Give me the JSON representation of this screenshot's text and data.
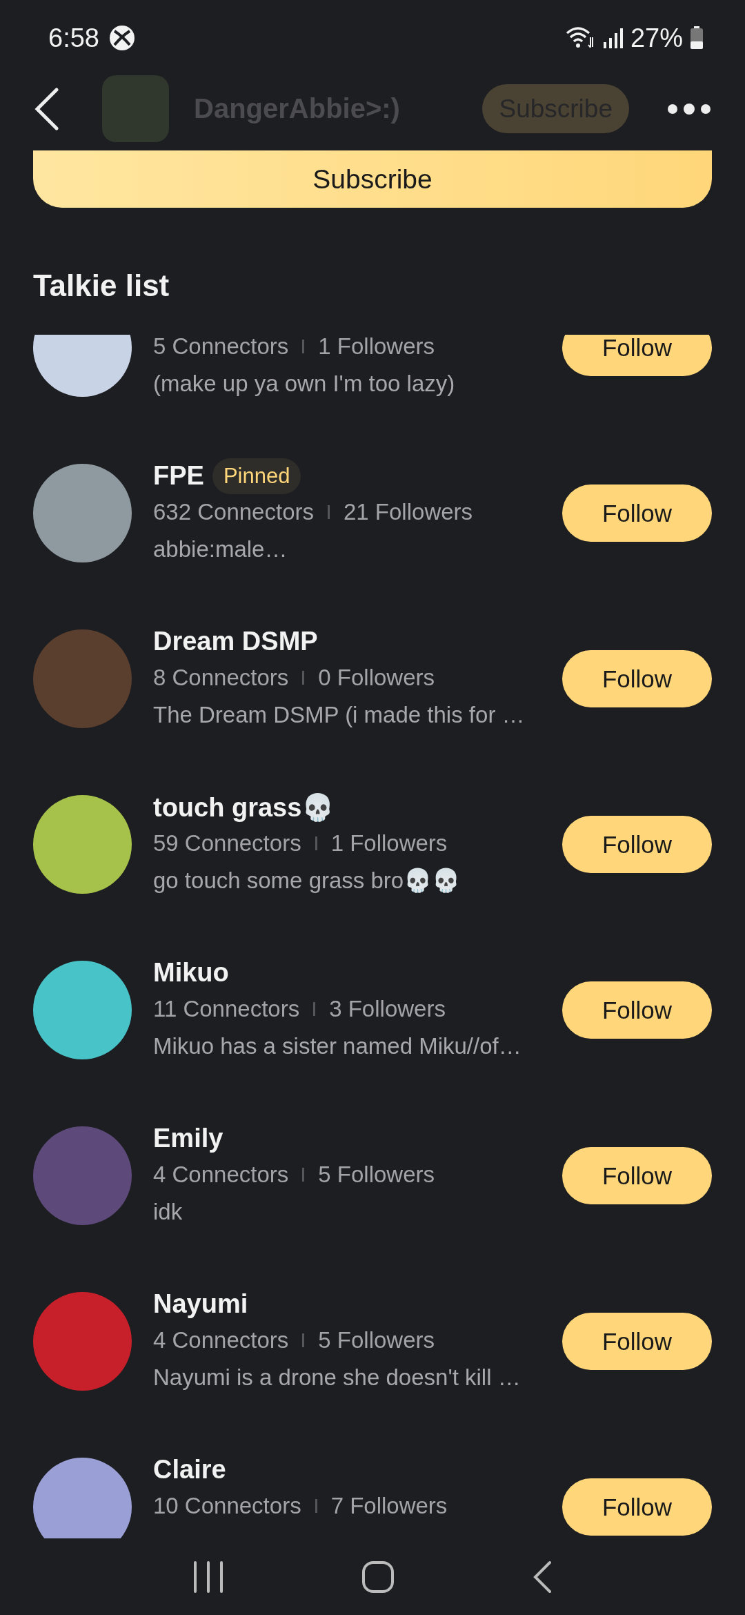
{
  "status_bar": {
    "time": "6:58",
    "battery": "27%"
  },
  "header": {
    "name": "DangerAbbie>:)",
    "subscribe": "Subscribe"
  },
  "subscribe_button": "Subscribe",
  "section_title": "Talkie list",
  "talkies": [
    {
      "stats": [
        "5 Connectors",
        "1 Followers"
      ],
      "description": "(make up ya own I'm too lazy)",
      "follow": "Follow"
    },
    {
      "name": "FPE",
      "badge": "Pinned",
      "stats": [
        "632 Connectors",
        "21 Followers"
      ],
      "description": "abbie:male…",
      "follow": "Follow"
    },
    {
      "name": "Dream DSMP",
      "stats": [
        "8 Connectors",
        "0 Followers"
      ],
      "description": "The Dream DSMP (i made this for …",
      "follow": "Follow"
    },
    {
      "name": "touch grass💀",
      "stats": [
        "59 Connectors",
        "1 Followers"
      ],
      "description": "go touch some grass bro💀💀",
      "follow": "Follow"
    },
    {
      "name": "Mikuo",
      "stats": [
        "11 Connectors",
        "3 Followers"
      ],
      "description": "Mikuo has a sister named Miku//of…",
      "follow": "Follow"
    },
    {
      "name": "Emily",
      "stats": [
        "4 Connectors",
        "5 Followers"
      ],
      "description": "idk",
      "follow": "Follow"
    },
    {
      "name": "Nayumi",
      "stats": [
        "4 Connectors",
        "5 Followers"
      ],
      "description": "Nayumi is a drone she doesn't kill …",
      "follow": "Follow"
    },
    {
      "name": "Claire",
      "stats": [
        "10 Connectors",
        "7 Followers"
      ],
      "follow": "Follow"
    }
  ]
}
